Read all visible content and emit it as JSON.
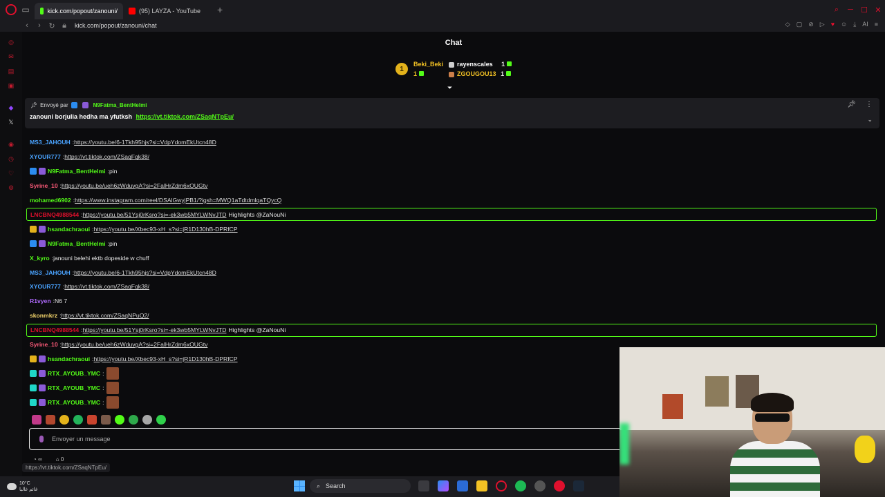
{
  "browser": {
    "tabs": [
      {
        "label": "kick.com/popout/zanouni/",
        "active": true,
        "icon": "kick-favicon",
        "color": "#53fc18"
      },
      {
        "label": "(95) LAYZA - YouTube",
        "active": false,
        "icon": "youtube-favicon",
        "color": "#ff0000"
      }
    ],
    "url": "kick.com/popout/zanouni/chat",
    "status_url": "https://vt.tiktok.com/ZSaqNTpEu/"
  },
  "chat": {
    "title": "Chat",
    "leaderboard": {
      "first": {
        "name": "Beki_Beki",
        "rank": "1",
        "count": "1"
      },
      "second": {
        "name": "rayenscales",
        "count": "1"
      },
      "third": {
        "name": "ZGOUGOU13",
        "count": "1"
      }
    },
    "pinned": {
      "sent_by_label": "Envoyé par",
      "user": "N9Fatma_BentHelmi",
      "text": "zanouni borjulia hedha ma yfutksh",
      "link": "https://vt.tiktok.com/ZSaqNTpEu/"
    },
    "messages": [
      {
        "user": "MS3_JAHOUH",
        "color": "#4aa3ff",
        "text": "https://youtu.be/6-1Tkh95hjs?si=VdpYdomEkUtcn48D",
        "link": true
      },
      {
        "user": "XYOUR777",
        "color": "#4aa3ff",
        "text": "https://vt.tiktok.com/ZSaqFqk38/",
        "link": true
      },
      {
        "user": "N9Fatma_BentHelmi",
        "color": "#53fc18",
        "text": "pin",
        "link": false,
        "badges": true
      },
      {
        "user": "Syrine_10",
        "color": "#ff5b7a",
        "text": "https://youtu.be/ueh6zWduvgA?si=2FalHrZdm6xOUGtv",
        "link": true
      },
      {
        "user": "mohamed6902",
        "color": "#53fc18",
        "text": "https://www.instagram.com/reel/DSAlGwyjPB1/?igsh=MWQ1aTdtdmlqaTQycQ",
        "link": true
      },
      {
        "user": "LNCBNQ4988544",
        "color": "#e0102d",
        "text": "https://youtu.be/51Ysj0rKsro?si=-ek3wb5MYLWNvJTD",
        "suffix": "Highlights @ZaNouNi",
        "link": true,
        "highlight": true
      },
      {
        "user": "hsandachraoui",
        "color": "#53fc18",
        "text": "https://youtu.be/Xbec93-xH_s?si=jR1D130hB-DPRfCP",
        "link": true,
        "badges": true
      },
      {
        "user": "N9Fatma_BentHelmi",
        "color": "#53fc18",
        "text": "pin",
        "link": false,
        "badges": true
      },
      {
        "user": "X_kyro",
        "color": "#53fc18",
        "text": "janouni belehi ektb dopeside w chuff",
        "link": false
      },
      {
        "user": "MS3_JAHOUH",
        "color": "#4aa3ff",
        "text": "https://youtu.be/6-1Tkh95hjs?si=VdpYdomEkUtcn48D",
        "link": true
      },
      {
        "user": "XYOUR777",
        "color": "#4aa3ff",
        "text": "https://vt.tiktok.com/ZSaqFqk38/",
        "link": true
      },
      {
        "user": "R1vyen",
        "color": "#b06bff",
        "text": "N6 7",
        "link": false
      },
      {
        "user": "skonmkrz",
        "color": "#f3d46b",
        "text": "https://vt.tiktok.com/ZSaqNPuQ2/",
        "link": true
      },
      {
        "user": "LNCBNQ4988544",
        "color": "#e0102d",
        "text": "https://youtu.be/51Ysj0rKsro?si=-ek3wb5MYLWNvJTD",
        "suffix": "Highlights @ZaNouNi",
        "link": true,
        "highlight": true
      },
      {
        "user": "Syrine_10",
        "color": "#ff5b7a",
        "text": "https://youtu.be/ueh6zWduvgA?si=2FalHrZdm6xOUGtv",
        "link": true
      },
      {
        "user": "hsandachraoui",
        "color": "#53fc18",
        "text": "https://youtu.be/Xbec93-xH_s?si=jR1D130hB-DPRfCP",
        "link": true,
        "badges": true
      },
      {
        "user": "RTX_AYOUB_YMC",
        "color": "#53fc18",
        "text": "",
        "emote": true,
        "badges": true
      },
      {
        "user": "RTX_AYOUB_YMC",
        "color": "#53fc18",
        "text": "",
        "emote": true,
        "badges": true
      },
      {
        "user": "RTX_AYOUB_YMC",
        "color": "#53fc18",
        "text": "",
        "emote": true,
        "badges": true
      }
    ],
    "input_placeholder": "Envoyer un message",
    "below_input": {
      "left": "∞",
      "right": "0"
    }
  },
  "taskbar": {
    "weather_temp": "10°C",
    "weather_desc": "غائم غالبا",
    "search_label": "Search"
  }
}
